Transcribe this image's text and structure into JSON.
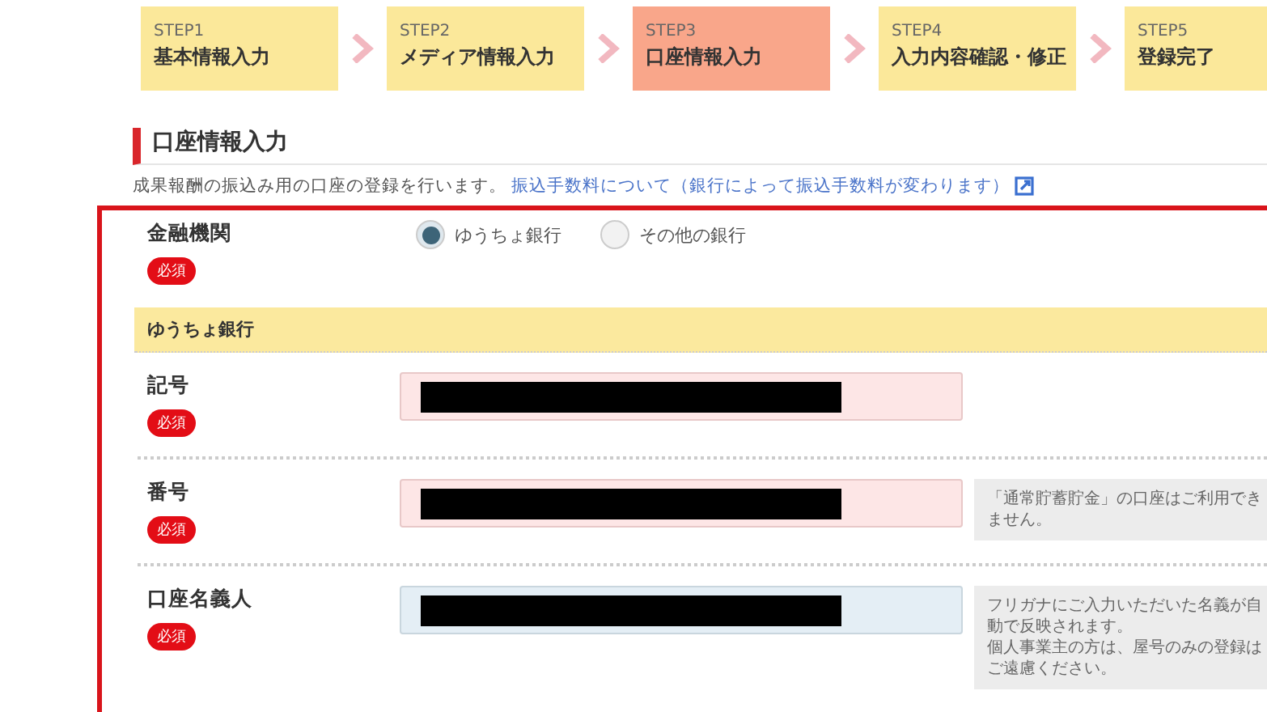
{
  "steps": [
    {
      "step": "STEP1",
      "label": "基本情報入力",
      "selected": false
    },
    {
      "step": "STEP2",
      "label": "メディア情報入力",
      "selected": false
    },
    {
      "step": "STEP3",
      "label": "口座情報入力",
      "selected": true
    },
    {
      "step": "STEP4",
      "label": "入力内容確認・修正",
      "selected": false
    },
    {
      "step": "STEP5",
      "label": "登録完了",
      "selected": false
    }
  ],
  "section": {
    "title": "口座情報入力",
    "description": "成果報酬の振込み用の口座の登録を行います。",
    "link": "振込手数料について（銀行によって振込手数料が変わります）"
  },
  "bank": {
    "label": "金融機関",
    "required": "必須",
    "options": [
      {
        "label": "ゆうちょ銀行",
        "selected": true
      },
      {
        "label": "その他の銀行",
        "selected": false
      }
    ]
  },
  "band": "ゆうちょ銀行",
  "fields": [
    {
      "label": "記号",
      "required": "必須",
      "invalid": true
    },
    {
      "label": "番号",
      "required": "必須",
      "invalid": true,
      "note": [
        "「通常貯蓄貯金」の口座はご利用でき",
        "ません。"
      ]
    },
    {
      "label": "口座名義人",
      "required": "必須",
      "invalid": false,
      "note": [
        "フリガナにご入力いただいた名義が自",
        "動で反映されます。",
        "個人事業主の方は、屋号のみの登録は",
        "ご遠慮ください。"
      ]
    }
  ]
}
